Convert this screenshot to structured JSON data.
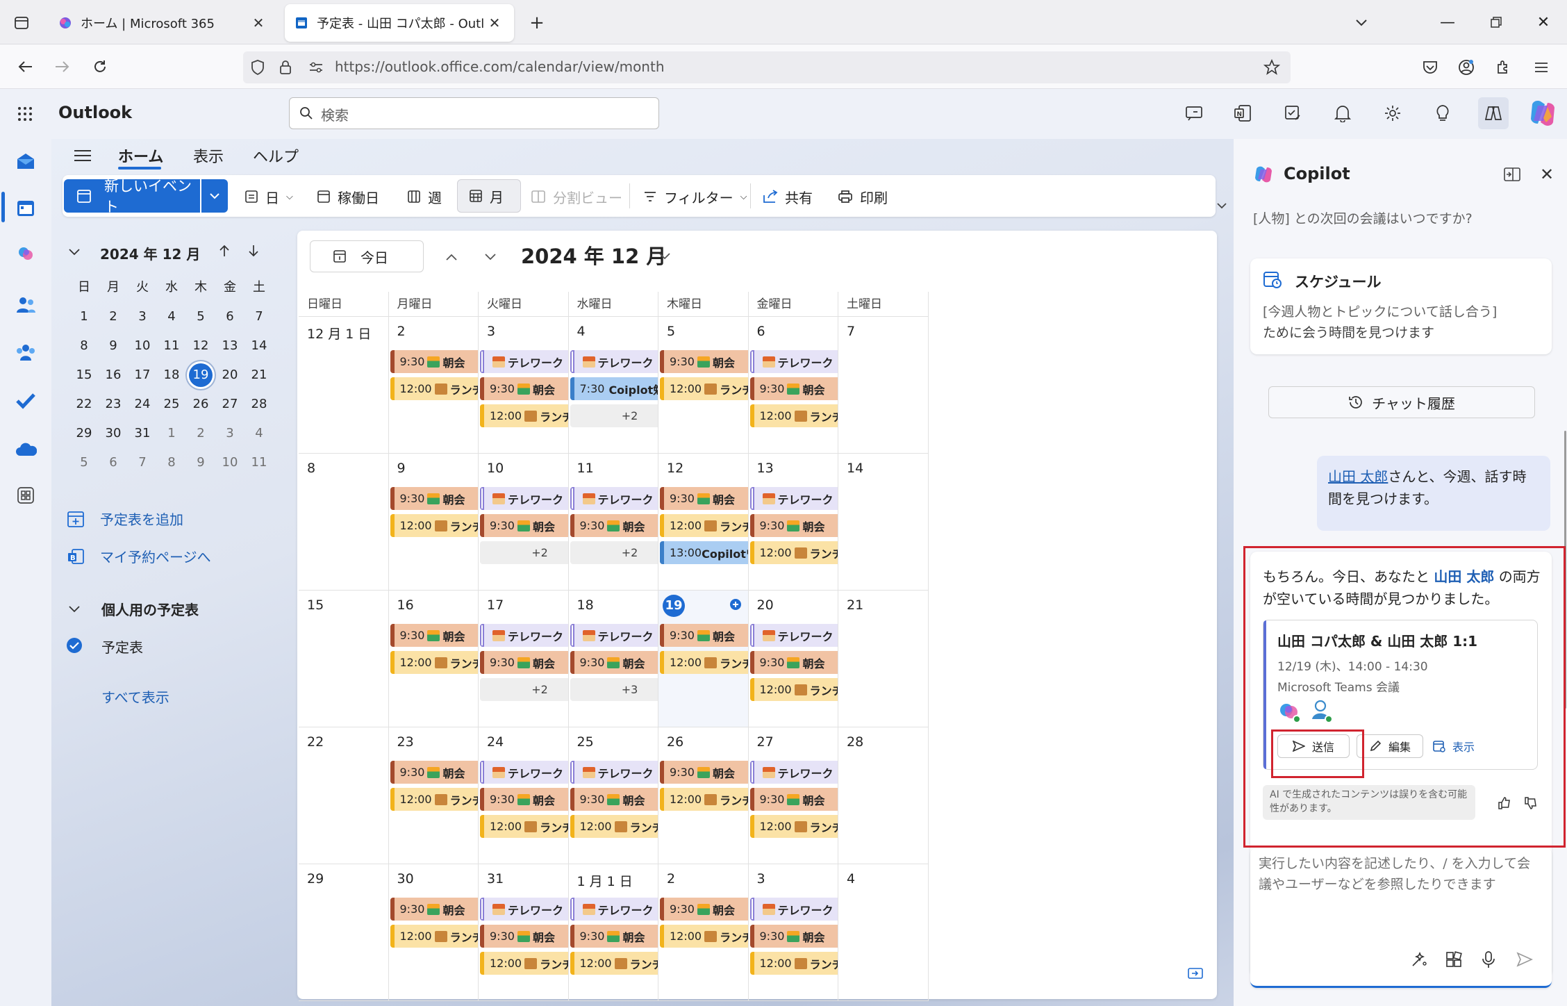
{
  "browser": {
    "tabs": [
      {
        "title": "ホーム | Microsoft 365"
      },
      {
        "title": "予定表 - 山田 コパ太郎 - Outlook"
      }
    ],
    "url": "https://outlook.office.com/calendar/view/month"
  },
  "outlook": {
    "app_name": "Outlook",
    "search_placeholder": "検索",
    "ribbon_tabs": [
      "ホーム",
      "表示",
      "ヘルプ"
    ],
    "ribbon": {
      "new_event": "新しいイベント",
      "day": "日",
      "workweek": "稼働日",
      "week": "週",
      "month": "月",
      "split": "分割ビュー",
      "filter": "フィルター",
      "share": "共有",
      "print": "印刷"
    }
  },
  "mini_calendar": {
    "title": "2024 年 12 月",
    "weekdays": [
      "日",
      "月",
      "火",
      "水",
      "木",
      "金",
      "土"
    ],
    "weeks": [
      [
        "1",
        "2",
        "3",
        "4",
        "5",
        "6",
        "7"
      ],
      [
        "8",
        "9",
        "10",
        "11",
        "12",
        "13",
        "14"
      ],
      [
        "15",
        "16",
        "17",
        "18",
        "19",
        "20",
        "21"
      ],
      [
        "22",
        "23",
        "24",
        "25",
        "26",
        "27",
        "28"
      ],
      [
        "29",
        "30",
        "31",
        "1",
        "2",
        "3",
        "4"
      ],
      [
        "5",
        "6",
        "7",
        "8",
        "9",
        "10",
        "11"
      ]
    ],
    "today": "19"
  },
  "leftnav": {
    "add_calendar": "予定表を追加",
    "booking": "マイ予約ページへ",
    "personal": "個人用の予定表",
    "calendar": "予定表",
    "show_all": "すべて表示"
  },
  "calendar": {
    "today_button": "今日",
    "title": "2024 年 12 月",
    "weekdays": [
      "日曜日",
      "月曜日",
      "火曜日",
      "水曜日",
      "木曜日",
      "金曜日",
      "土曜日"
    ],
    "weeks": [
      [
        {
          "day": "12 月 1 日",
          "events": []
        },
        {
          "day": "2",
          "events": [
            {
              "type": "morning",
              "text": "9:30",
              "label": "朝会"
            },
            {
              "type": "lunch",
              "text": "12:00",
              "label": "ランチタ"
            }
          ]
        },
        {
          "day": "3",
          "events": [
            {
              "type": "tele",
              "text": "",
              "label": "テレワーク"
            },
            {
              "type": "morning",
              "text": "9:30",
              "label": "朝会"
            },
            {
              "type": "lunch",
              "text": "12:00",
              "label": "ランチタ"
            }
          ]
        },
        {
          "day": "4",
          "events": [
            {
              "type": "tele",
              "text": "",
              "label": "テレワーク"
            },
            {
              "type": "blue",
              "text": "7:30",
              "label": "Coiplot勉強会"
            },
            {
              "type": "more",
              "text": "+2",
              "label": ""
            }
          ]
        },
        {
          "day": "5",
          "events": [
            {
              "type": "morning",
              "text": "9:30",
              "label": "朝会"
            },
            {
              "type": "lunch",
              "text": "12:00",
              "label": "ランチタ"
            }
          ]
        },
        {
          "day": "6",
          "events": [
            {
              "type": "tele",
              "text": "",
              "label": "テレワーク"
            },
            {
              "type": "morning",
              "text": "9:30",
              "label": "朝会"
            },
            {
              "type": "lunch",
              "text": "12:00",
              "label": "ランチタ"
            }
          ]
        },
        {
          "day": "7",
          "events": []
        }
      ],
      [
        {
          "day": "8",
          "events": []
        },
        {
          "day": "9",
          "events": [
            {
              "type": "morning",
              "text": "9:30",
              "label": "朝会"
            },
            {
              "type": "lunch",
              "text": "12:00",
              "label": "ランチタ"
            }
          ]
        },
        {
          "day": "10",
          "events": [
            {
              "type": "tele",
              "text": "",
              "label": "テレワーク"
            },
            {
              "type": "morning",
              "text": "9:30",
              "label": "朝会"
            },
            {
              "type": "more",
              "text": "+2",
              "label": ""
            }
          ]
        },
        {
          "day": "11",
          "events": [
            {
              "type": "tele",
              "text": "",
              "label": "テレワーク"
            },
            {
              "type": "morning",
              "text": "9:30",
              "label": "朝会"
            },
            {
              "type": "more",
              "text": "+2",
              "label": ""
            }
          ]
        },
        {
          "day": "12",
          "events": [
            {
              "type": "morning",
              "text": "9:30",
              "label": "朝会"
            },
            {
              "type": "lunch",
              "text": "12:00",
              "label": "ランチタ"
            },
            {
              "type": "blue",
              "text": "13:00",
              "label": "Copilotワーク:"
            }
          ]
        },
        {
          "day": "13",
          "events": [
            {
              "type": "tele",
              "text": "",
              "label": "テレワーク"
            },
            {
              "type": "morning",
              "text": "9:30",
              "label": "朝会"
            },
            {
              "type": "lunch",
              "text": "12:00",
              "label": "ランチタ"
            }
          ]
        },
        {
          "day": "14",
          "events": []
        }
      ],
      [
        {
          "day": "15",
          "events": []
        },
        {
          "day": "16",
          "events": [
            {
              "type": "morning",
              "text": "9:30",
              "label": "朝会"
            },
            {
              "type": "lunch",
              "text": "12:00",
              "label": "ランチタ"
            }
          ]
        },
        {
          "day": "17",
          "events": [
            {
              "type": "tele",
              "text": "",
              "label": "テレワーク"
            },
            {
              "type": "morning",
              "text": "9:30",
              "label": "朝会"
            },
            {
              "type": "more",
              "text": "+2",
              "label": ""
            }
          ]
        },
        {
          "day": "18",
          "events": [
            {
              "type": "tele",
              "text": "",
              "label": "テレワーク"
            },
            {
              "type": "morning",
              "text": "9:30",
              "label": "朝会"
            },
            {
              "type": "more",
              "text": "+3",
              "label": ""
            }
          ]
        },
        {
          "day": "19",
          "today": true,
          "events": [
            {
              "type": "morning",
              "text": "9:30",
              "label": "朝会"
            },
            {
              "type": "lunch",
              "text": "12:00",
              "label": "ランチタ"
            }
          ]
        },
        {
          "day": "20",
          "events": [
            {
              "type": "tele",
              "text": "",
              "label": "テレワーク"
            },
            {
              "type": "morning",
              "text": "9:30",
              "label": "朝会"
            },
            {
              "type": "lunch",
              "text": "12:00",
              "label": "ランチタ"
            }
          ]
        },
        {
          "day": "21",
          "events": []
        }
      ],
      [
        {
          "day": "22",
          "events": []
        },
        {
          "day": "23",
          "events": [
            {
              "type": "morning",
              "text": "9:30",
              "label": "朝会"
            },
            {
              "type": "lunch",
              "text": "12:00",
              "label": "ランチタ"
            }
          ]
        },
        {
          "day": "24",
          "events": [
            {
              "type": "tele",
              "text": "",
              "label": "テレワーク"
            },
            {
              "type": "morning",
              "text": "9:30",
              "label": "朝会"
            },
            {
              "type": "lunch",
              "text": "12:00",
              "label": "ランチタ"
            }
          ]
        },
        {
          "day": "25",
          "events": [
            {
              "type": "tele",
              "text": "",
              "label": "テレワーク"
            },
            {
              "type": "morning",
              "text": "9:30",
              "label": "朝会"
            },
            {
              "type": "lunch",
              "text": "12:00",
              "label": "ランチタ"
            }
          ]
        },
        {
          "day": "26",
          "events": [
            {
              "type": "morning",
              "text": "9:30",
              "label": "朝会"
            },
            {
              "type": "lunch",
              "text": "12:00",
              "label": "ランチタ"
            }
          ]
        },
        {
          "day": "27",
          "events": [
            {
              "type": "tele",
              "text": "",
              "label": "テレワーク"
            },
            {
              "type": "morning",
              "text": "9:30",
              "label": "朝会"
            },
            {
              "type": "lunch",
              "text": "12:00",
              "label": "ランチタ"
            }
          ]
        },
        {
          "day": "28",
          "events": []
        }
      ],
      [
        {
          "day": "29",
          "events": []
        },
        {
          "day": "30",
          "events": [
            {
              "type": "morning",
              "text": "9:30",
              "label": "朝会"
            },
            {
              "type": "lunch",
              "text": "12:00",
              "label": "ランチタ"
            }
          ]
        },
        {
          "day": "31",
          "events": [
            {
              "type": "tele",
              "text": "",
              "label": "テレワーク"
            },
            {
              "type": "morning",
              "text": "9:30",
              "label": "朝会"
            },
            {
              "type": "lunch",
              "text": "12:00",
              "label": "ランチタ"
            }
          ]
        },
        {
          "day": "1 月 1 日",
          "events": [
            {
              "type": "tele",
              "text": "",
              "label": "テレワーク"
            },
            {
              "type": "morning",
              "text": "9:30",
              "label": "朝会"
            },
            {
              "type": "lunch",
              "text": "12:00",
              "label": "ランチタ"
            }
          ]
        },
        {
          "day": "2",
          "events": [
            {
              "type": "morning",
              "text": "9:30",
              "label": "朝会"
            },
            {
              "type": "lunch",
              "text": "12:00",
              "label": "ランチタ"
            }
          ]
        },
        {
          "day": "3",
          "events": [
            {
              "type": "tele",
              "text": "",
              "label": "テレワーク"
            },
            {
              "type": "morning",
              "text": "9:30",
              "label": "朝会"
            },
            {
              "type": "lunch",
              "text": "12:00",
              "label": "ランチタ"
            }
          ]
        },
        {
          "day": "4",
          "events": []
        }
      ]
    ]
  },
  "copilot": {
    "title": "Copilot",
    "prev_prompt": "[人物] との次回の会議はいつですか?",
    "schedule_title": "スケジュール",
    "schedule_desc_bracket": "[今週人物とトピックについて話し合う]",
    "schedule_desc_rest": "ために会う時間を見つけます",
    "history": "チャット履歴",
    "user_msg_name": "山田 太郎",
    "user_msg_rest": "さんと、今週、話す時間を見つけます。",
    "reply_1": "もちろん。今日、あなたと",
    "reply_name": "山田 太郎",
    "reply_2": "の両方が空いている時間が見つかりました。",
    "meeting_title": "山田 コパ太郎 & 山田 太郎 1:1",
    "meeting_time": "12/19 (木)、14:00 - 14:30",
    "meeting_loc": "Microsoft Teams 会議",
    "send": "送信",
    "edit": "編集",
    "view": "表示",
    "disclaimer": "AI で生成されたコンテンツは誤りを含む可能性があります。",
    "input_placeholder": "実行したい内容を記述したり、/ を入力して会議やユーザーなどを参照したりできます"
  }
}
